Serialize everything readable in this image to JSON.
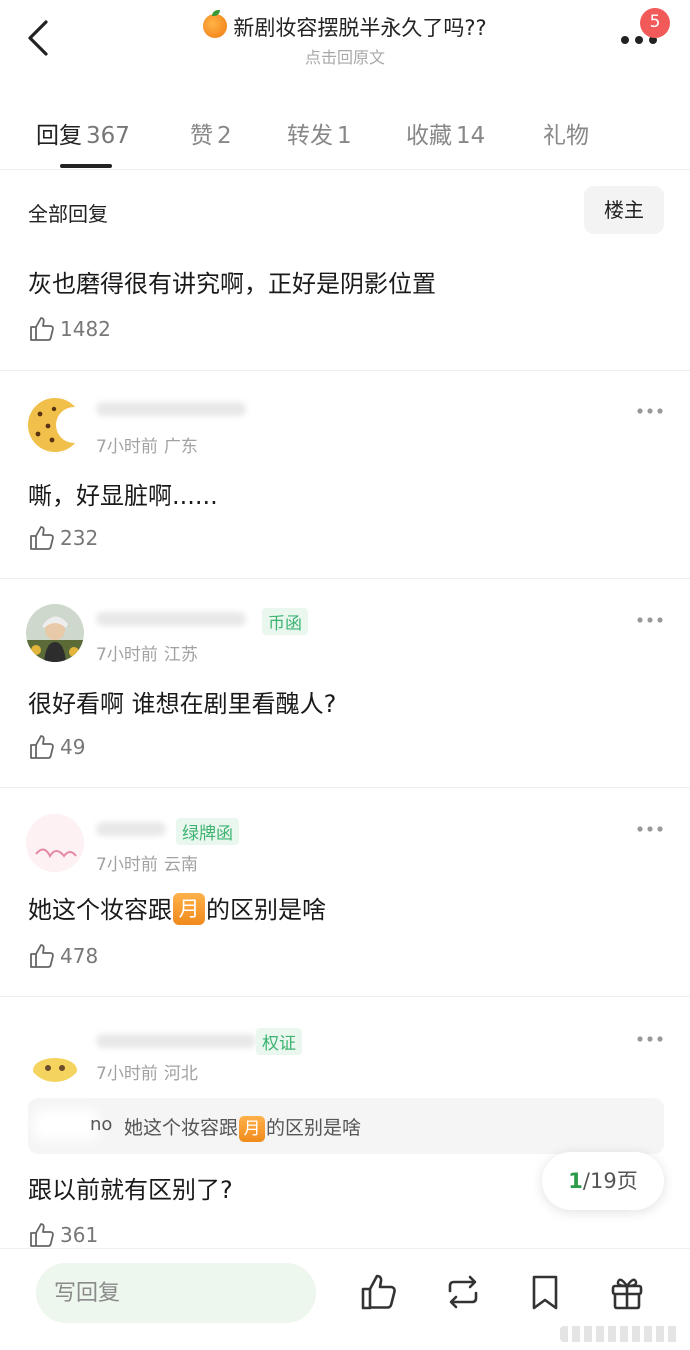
{
  "header": {
    "title": "新剧妆容摆脱半永久了吗??",
    "subtitle": "点击回原文",
    "notification_count": "5"
  },
  "tabs": [
    {
      "label": "回复",
      "count": "367",
      "active": true
    },
    {
      "label": "赞",
      "count": "2",
      "active": false
    },
    {
      "label": "转发",
      "count": "1",
      "active": false
    },
    {
      "label": "收藏",
      "count": "14",
      "active": false
    },
    {
      "label": "礼物",
      "count": "",
      "active": false
    }
  ],
  "filter": {
    "title": "全部回复",
    "owner_button": "楼主"
  },
  "comments": [
    {
      "text": "灰也磨得很有讲究啊，正好是阴影位置",
      "likes": "1482"
    },
    {
      "time": "7小时前",
      "location": "广东",
      "text": "嘶，好显脏啊......",
      "likes": "232"
    },
    {
      "time": "7小时前",
      "location": "江苏",
      "tag": "币函",
      "text": "很好看啊 谁想在剧里看醜人?",
      "likes": "49"
    },
    {
      "time": "7小时前",
      "location": "云南",
      "tag": "绿牌函",
      "text_before": "她这个妆容跟",
      "emoji": "月",
      "text_after": "的区别是啥",
      "likes": "478"
    },
    {
      "time": "7小时前",
      "location": "河北",
      "tag": "权证",
      "quote_name": "no",
      "quote_before": "她这个妆容跟",
      "quote_emoji": "月",
      "quote_after": "的区别是啥",
      "text": "跟以前就有区别了?",
      "likes": "361"
    }
  ],
  "pager": {
    "current": "1",
    "total": "/19页"
  },
  "bottom": {
    "reply_placeholder": "写回复"
  },
  "colors": {
    "accent_green": "#2e9b49",
    "badge_red": "#f25a5a",
    "tag_green": "#3cb371"
  }
}
